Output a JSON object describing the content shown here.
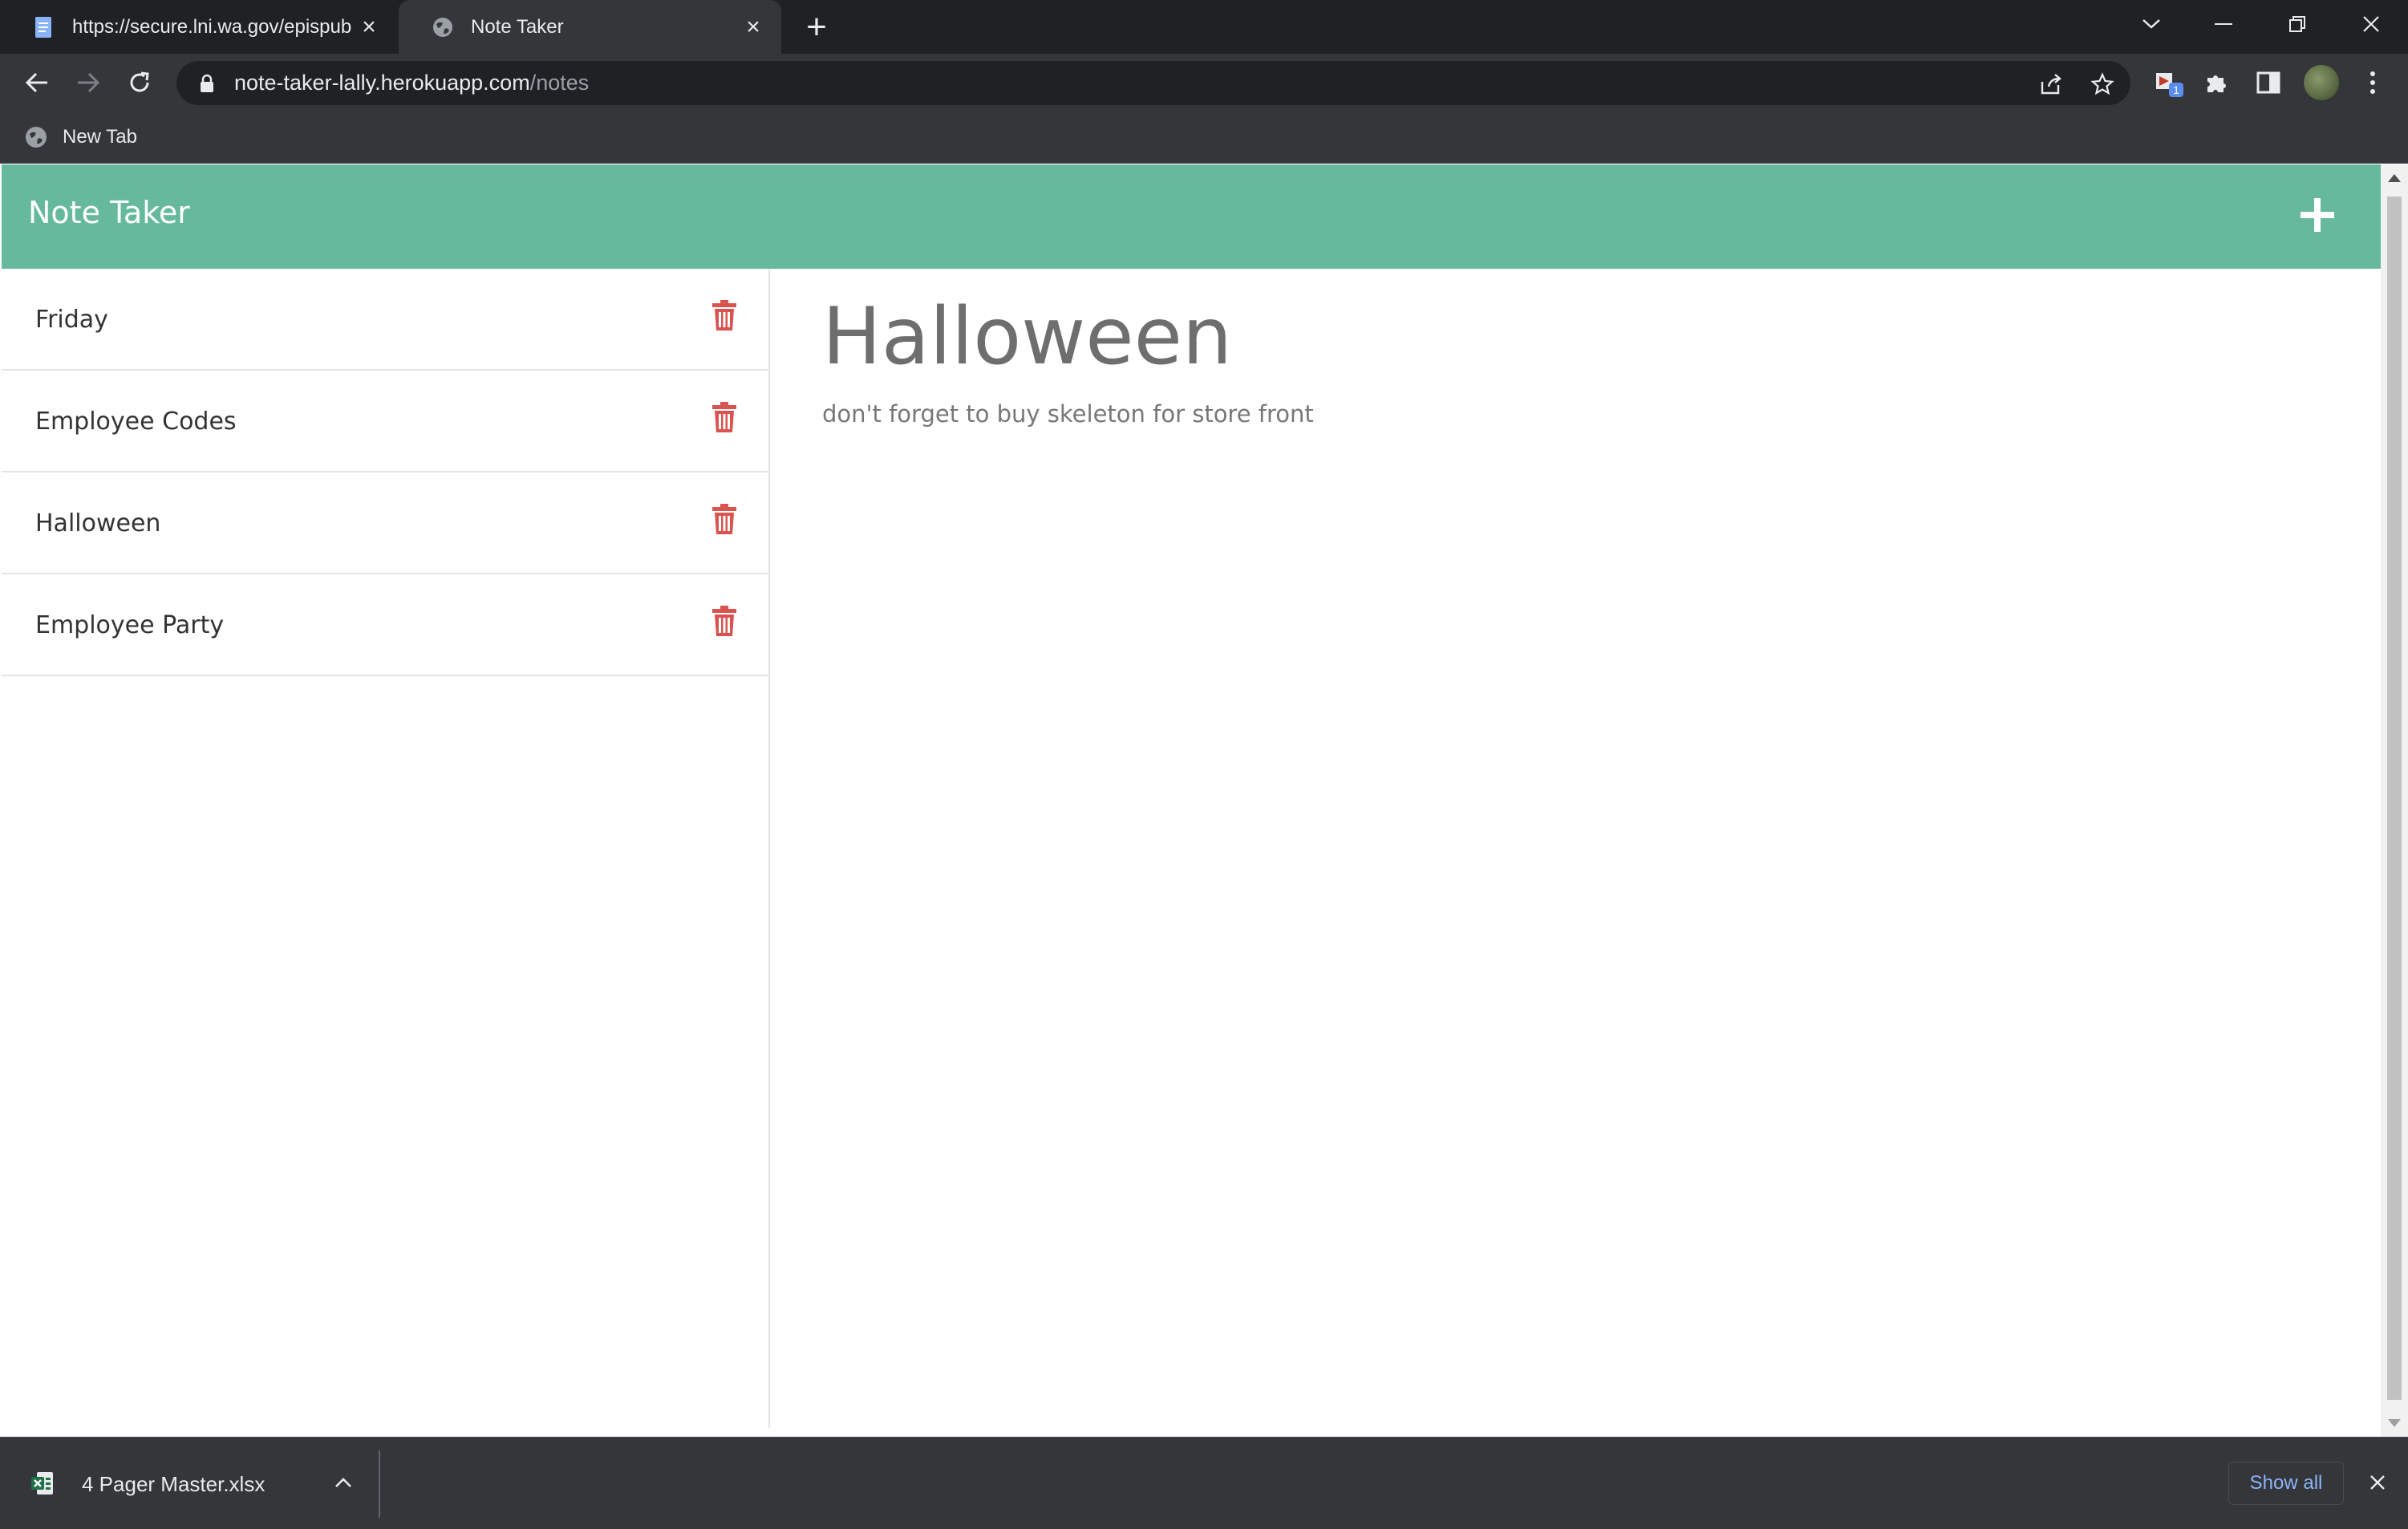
{
  "browser": {
    "tabs": [
      {
        "title": "https://secure.lni.wa.gov/epispub",
        "active": false
      },
      {
        "title": "Note Taker",
        "active": true
      }
    ],
    "url_host": "note-taker-lally.herokuapp.com",
    "url_path": "/notes",
    "bookmarks": [
      {
        "label": "New Tab"
      }
    ],
    "extension_badge": "1"
  },
  "app": {
    "title": "Note Taker",
    "accent_color": "#66b99d",
    "delete_color": "#d9534f",
    "notes": [
      {
        "title": "Friday"
      },
      {
        "title": "Employee Codes"
      },
      {
        "title": "Halloween"
      },
      {
        "title": "Employee Party"
      }
    ],
    "active_note": {
      "title": "Halloween",
      "text": "don't forget to buy skeleton for store front"
    }
  },
  "downloads": {
    "items": [
      {
        "name": "4 Pager Master.xlsx"
      }
    ],
    "show_all_label": "Show all"
  }
}
